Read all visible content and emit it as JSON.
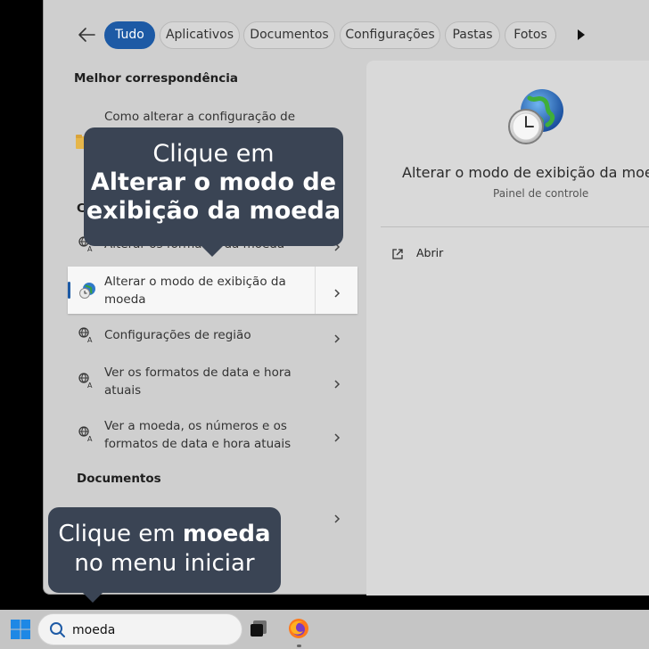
{
  "filters": {
    "chips": [
      {
        "label": "Tudo",
        "active": true
      },
      {
        "label": "Aplicativos"
      },
      {
        "label": "Documentos"
      },
      {
        "label": "Configurações"
      },
      {
        "label": "Pastas"
      },
      {
        "label": "Fotos"
      }
    ]
  },
  "left": {
    "best_match_title": "Melhor correspondência",
    "best_match_text": "Como alterar a configuração de",
    "settings_title_partial": "C",
    "rows": [
      {
        "label_line1": "Alterar os formatos da moeda",
        "label_line2": ""
      },
      {
        "label_line1": "Alterar o modo de exibição da",
        "label_line2": "moeda"
      },
      {
        "label_line1": "Configurações de região",
        "label_line2": ""
      },
      {
        "label_line1": "Ver os formatos de data e hora",
        "label_line2": "atuais"
      },
      {
        "label_line1": "Ver a moeda, os números e os",
        "label_line2": "formatos de data e hora atuais"
      }
    ],
    "documents_title": "Documentos"
  },
  "preview": {
    "title": "Alterar o modo de exibição da moeda",
    "subtitle": "Painel de controle",
    "open_label": "Abrir"
  },
  "tooltip_top": {
    "line1": "Clique em",
    "line2": "Alterar o modo de",
    "line3": "exibição da moeda"
  },
  "tooltip_bottom": {
    "prefix": "Clique em ",
    "bold": "moeda",
    "line2": "no menu iniciar"
  },
  "taskbar": {
    "search_value": "moeda"
  }
}
